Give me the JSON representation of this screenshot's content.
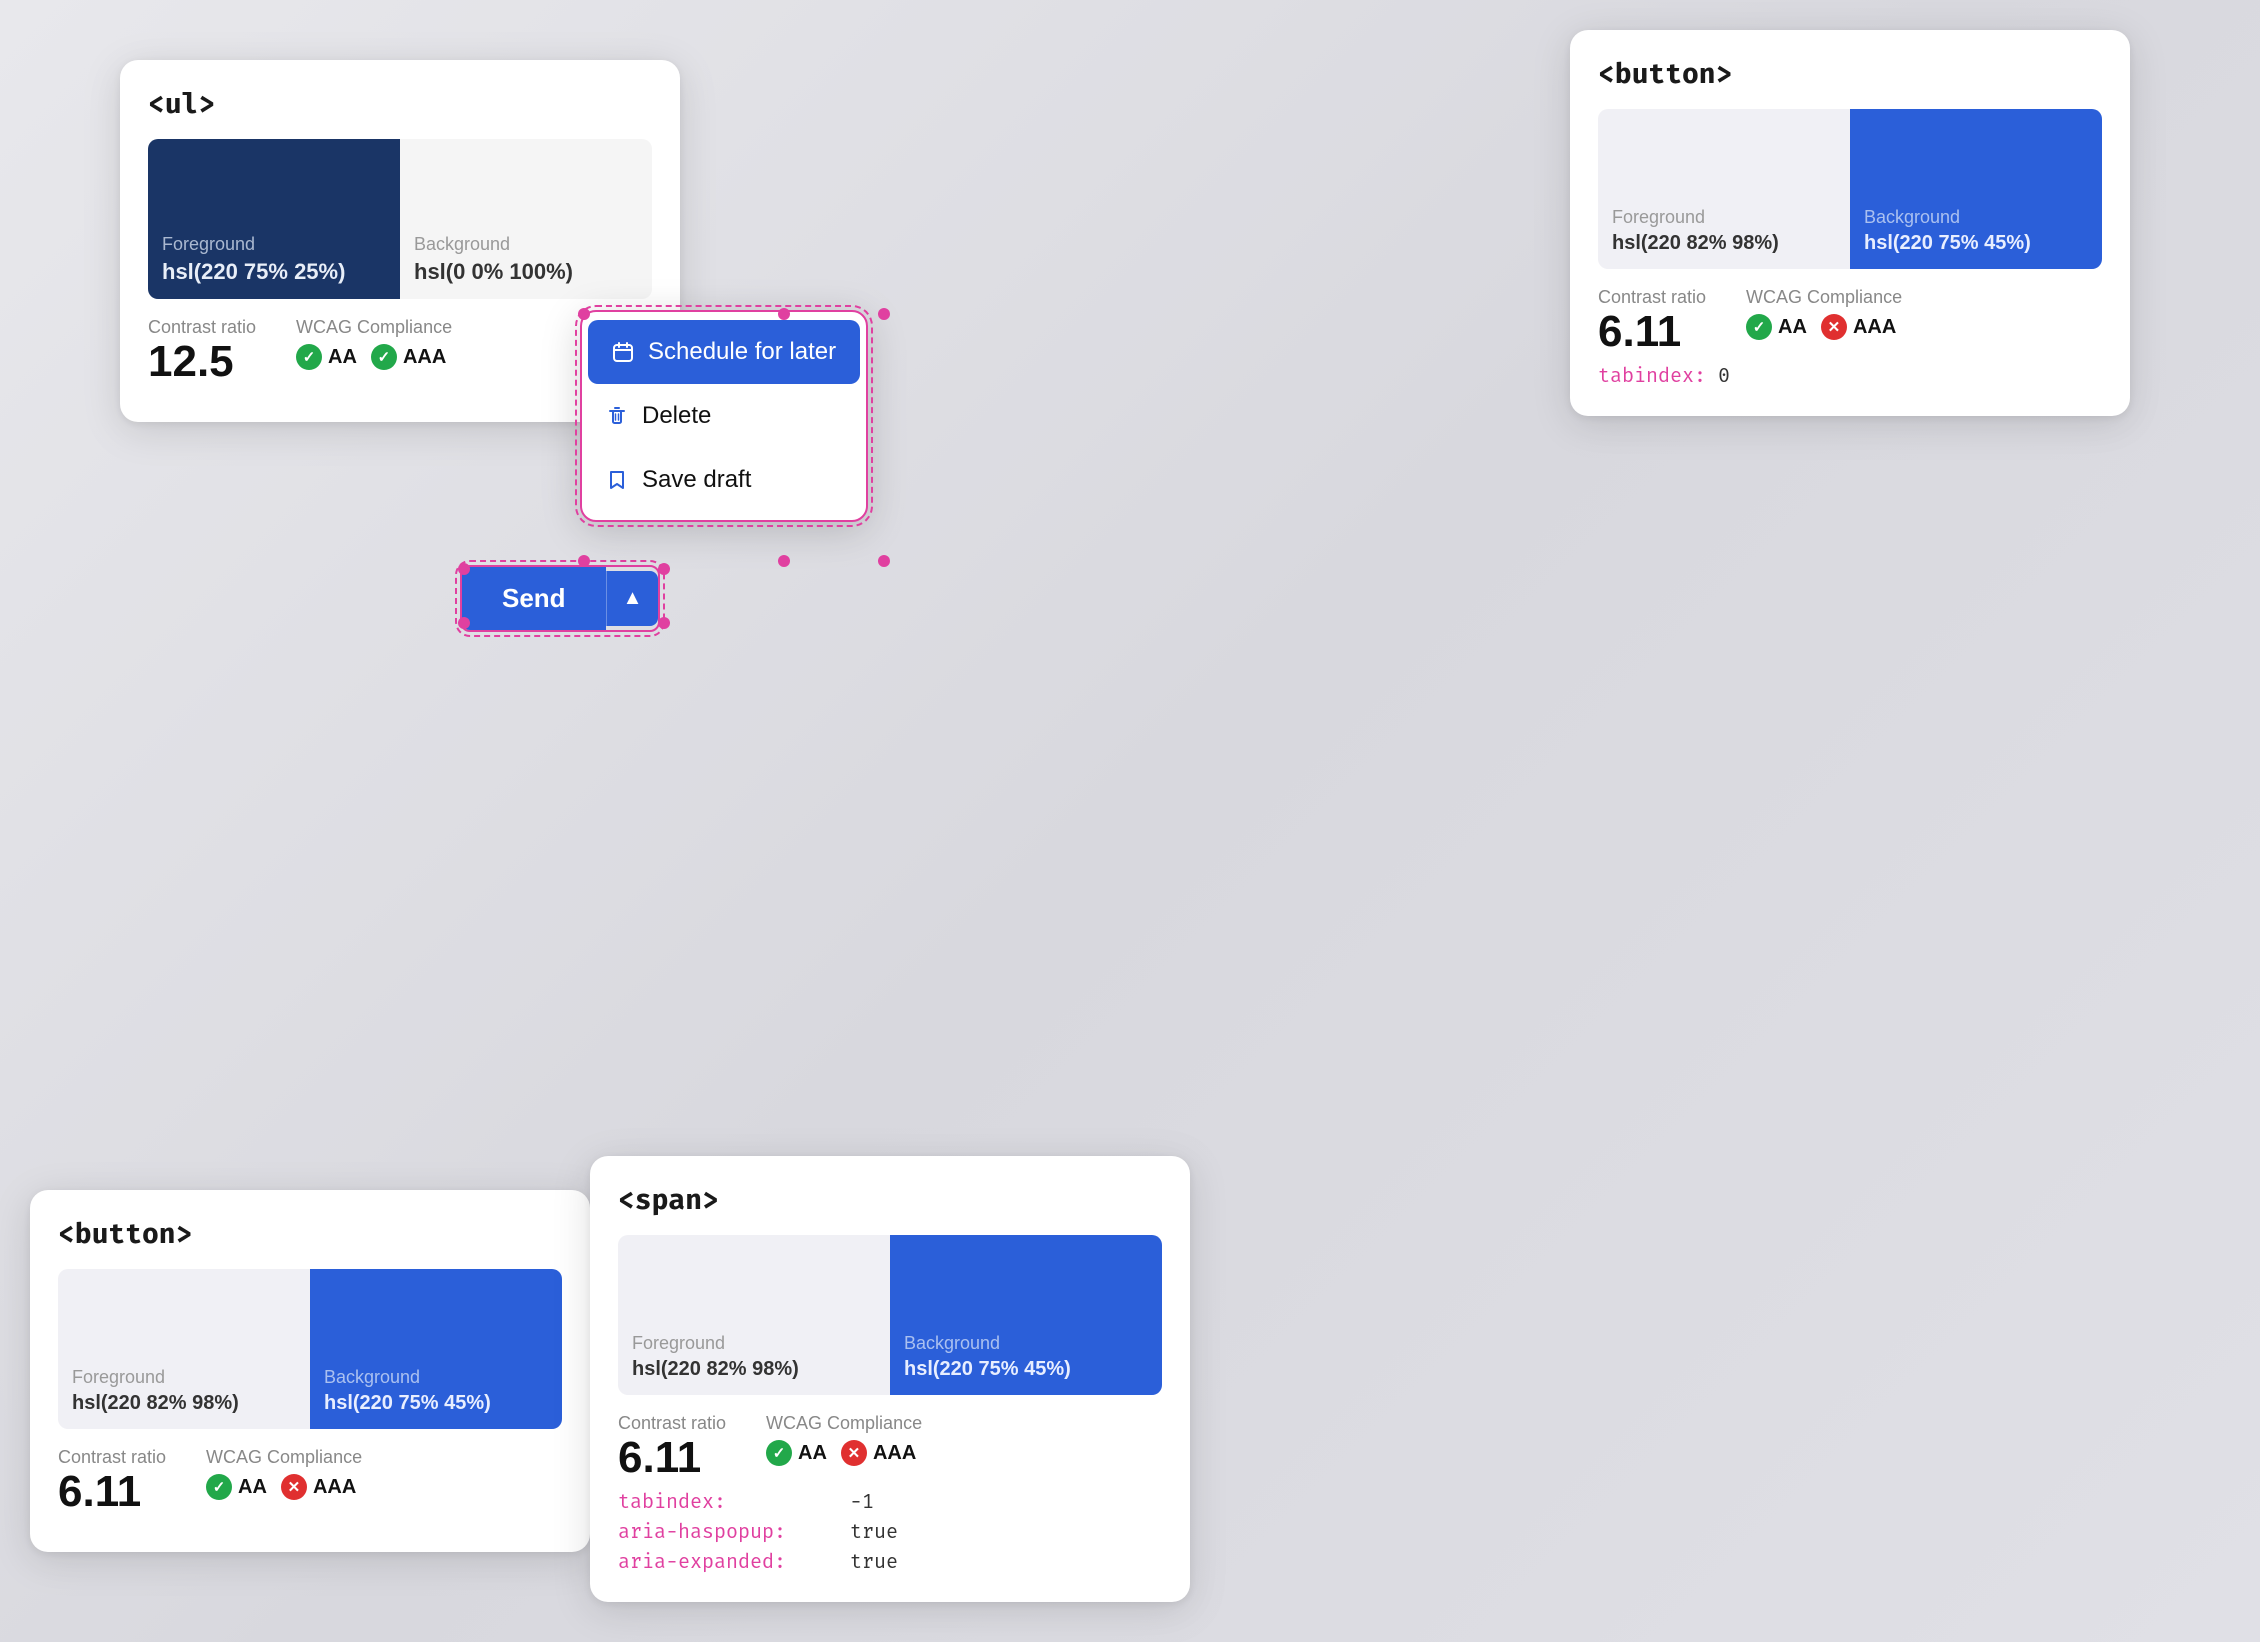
{
  "cards": {
    "ul": {
      "tag": "<ul>",
      "swatch_fg_label": "Foreground",
      "swatch_fg_value": "hsl(220 75% 25%)",
      "swatch_bg_label": "Background",
      "swatch_bg_value": "hsl(0 0% 100%)",
      "contrast_label": "Contrast ratio",
      "contrast_value": "12.5",
      "wcag_label": "WCAG Compliance",
      "aa_label": "AA",
      "aaa_label": "AAA",
      "aa_pass": true,
      "aaa_pass": true
    },
    "button_top": {
      "tag": "<button>",
      "swatch_fg_label": "Foreground",
      "swatch_fg_value": "hsl(220 82% 98%)",
      "swatch_bg_label": "Background",
      "swatch_bg_value": "hsl(220 75% 45%)",
      "contrast_label": "Contrast ratio",
      "contrast_value": "6.11",
      "wcag_label": "WCAG Compliance",
      "aa_label": "AA",
      "aaa_label": "AAA",
      "aa_pass": true,
      "aaa_pass": false,
      "tabindex_label": "tabindex:",
      "tabindex_value": "0"
    },
    "button_bottom": {
      "tag": "<button>",
      "swatch_fg_label": "Foreground",
      "swatch_fg_value": "hsl(220 82% 98%)",
      "swatch_bg_label": "Background",
      "swatch_bg_value": "hsl(220 75% 45%)",
      "contrast_label": "Contrast ratio",
      "contrast_value": "6.11",
      "wcag_label": "WCAG Compliance",
      "aa_label": "AA",
      "aaa_label": "AAA",
      "aa_pass": true,
      "aaa_pass": false
    },
    "span": {
      "tag": "<span>",
      "swatch_fg_label": "Foreground",
      "swatch_fg_value": "hsl(220 82% 98%)",
      "swatch_bg_label": "Background",
      "swatch_bg_value": "hsl(220 75% 45%)",
      "contrast_label": "Contrast ratio",
      "contrast_value": "6.11",
      "wcag_label": "WCAG Compliance",
      "aa_label": "AA",
      "aaa_label": "AAA",
      "aa_pass": true,
      "aaa_pass": false,
      "tabindex_label": "tabindex:",
      "tabindex_value": "-1",
      "aria_haspopup_label": "aria-haspopup:",
      "aria_haspopup_value": "true",
      "aria_expanded_label": "aria-expanded:",
      "aria_expanded_value": "true"
    }
  },
  "dropdown": {
    "items": [
      {
        "label": "Schedule for later",
        "icon": "calendar"
      },
      {
        "label": "Delete",
        "icon": "trash"
      },
      {
        "label": "Save draft",
        "icon": "bookmark"
      }
    ]
  },
  "send_button": {
    "label": "Send",
    "chevron": "▲"
  }
}
